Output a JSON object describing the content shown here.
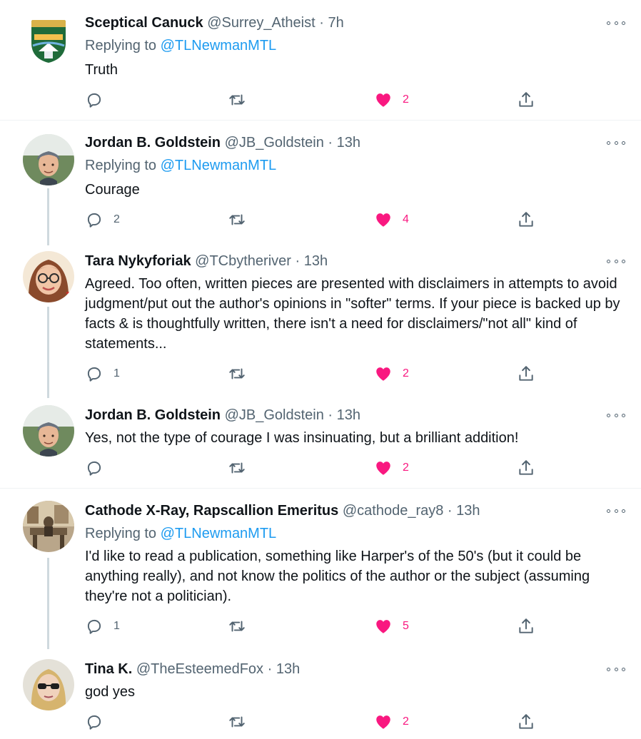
{
  "tweets": [
    {
      "name": "Sceptical Canuck",
      "handle": "@Surrey_Atheist",
      "sep": "·",
      "time": "7h",
      "replying_prefix": "Replying to",
      "replying_to": "@TLNewmanMTL",
      "text": "Truth",
      "replies": "",
      "retweets": "",
      "likes": "2",
      "liked": true,
      "avatar_icon": "city-crest-avatar"
    },
    {
      "name": "Jordan B. Goldstein",
      "handle": "@JB_Goldstein",
      "sep": "·",
      "time": "13h",
      "replying_prefix": "Replying to",
      "replying_to": "@TLNewmanMTL",
      "text": "Courage",
      "replies": "2",
      "retweets": "",
      "likes": "4",
      "liked": true,
      "avatar_icon": "person-beanie-avatar"
    },
    {
      "name": "Tara Nykyforiak",
      "handle": "@TCbytheriver",
      "sep": "·",
      "time": "13h",
      "text": "Agreed. Too often, written pieces are presented with disclaimers in attempts to avoid judgment/put out the author's opinions in \"softer\" terms. If your piece is backed up by facts & is thoughtfully written, there isn't a need for disclaimers/\"not all\" kind of statements...",
      "replies": "1",
      "retweets": "",
      "likes": "2",
      "liked": true,
      "avatar_icon": "person-glasses-avatar"
    },
    {
      "name": "Jordan B. Goldstein",
      "handle": "@JB_Goldstein",
      "sep": "·",
      "time": "13h",
      "text": "Yes, not the type of courage I was insinuating, but a brilliant addition!",
      "replies": "",
      "retweets": "",
      "likes": "2",
      "liked": true,
      "avatar_icon": "person-beanie-avatar"
    },
    {
      "name": "Cathode X-Ray, Rapscallion Emeritus",
      "handle": "@cathode_ray8",
      "sep": "·",
      "time": "13h",
      "replying_prefix": "Replying to",
      "replying_to": "@TLNewmanMTL",
      "text": "I'd like to read a publication, something like Harper's of the 50's (but it could be anything really), and not know the politics of the author or the subject (assuming they're not a politician).",
      "replies": "1",
      "retweets": "",
      "likes": "5",
      "liked": true,
      "avatar_icon": "vintage-room-avatar"
    },
    {
      "name": "Tina K.",
      "handle": "@TheEsteemedFox",
      "sep": "·",
      "time": "13h",
      "text": "god yes",
      "replies": "",
      "retweets": "",
      "likes": "2",
      "liked": true,
      "avatar_icon": "person-sunglasses-avatar"
    }
  ],
  "colors": {
    "link": "#1d9bf0",
    "like": "#f91880",
    "muted": "#536471",
    "thread_line": "#cfd9de"
  },
  "icons": {
    "reply": "reply-icon",
    "retweet": "retweet-icon",
    "like": "heart-icon",
    "share": "share-icon",
    "more": "more-options-icon"
  }
}
